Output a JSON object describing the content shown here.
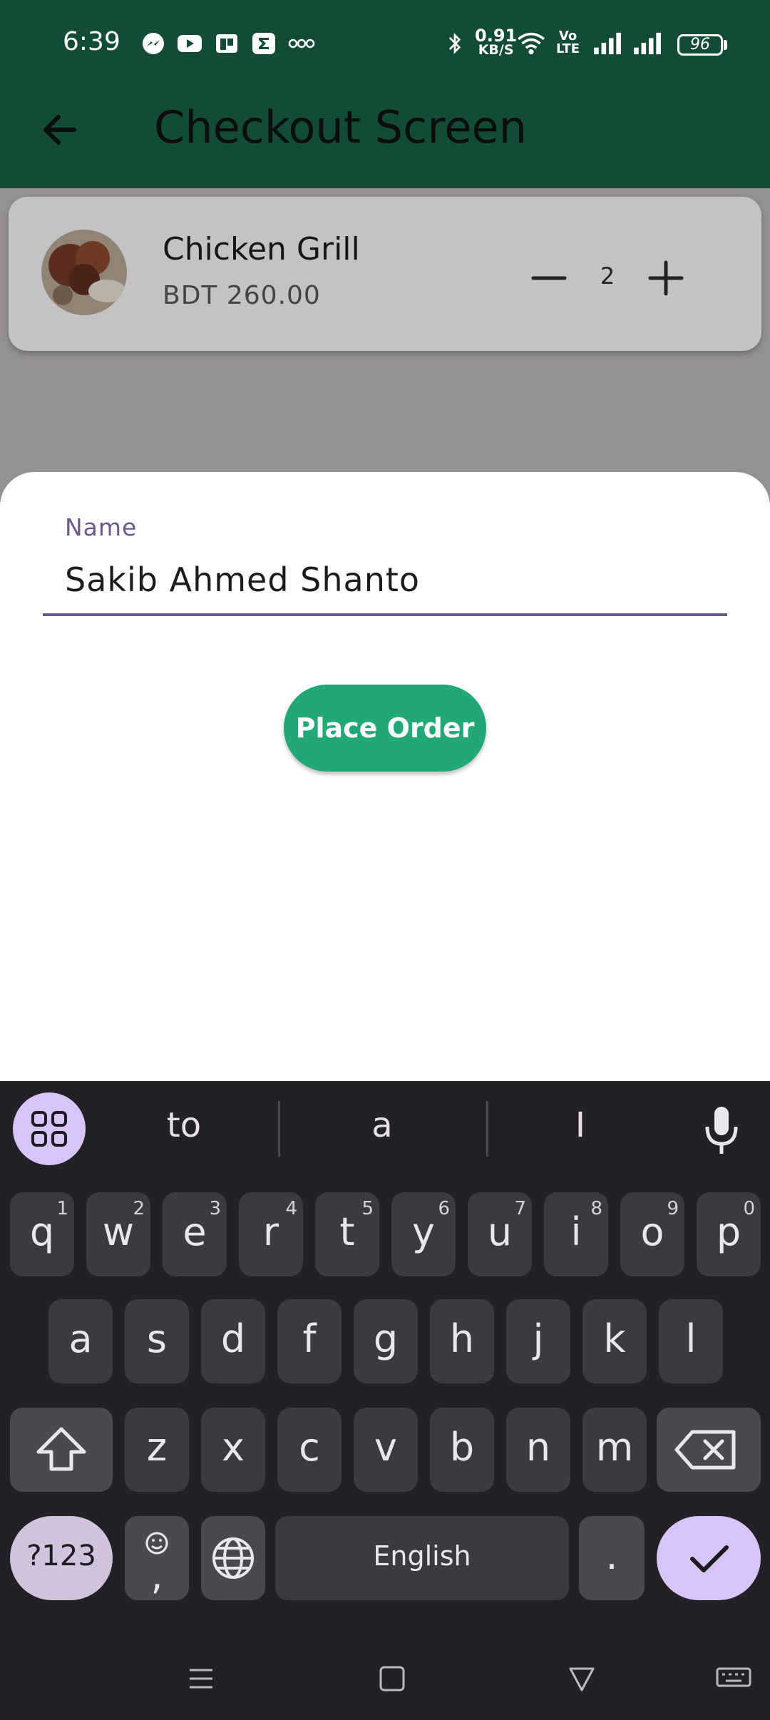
{
  "status_bar": {
    "time": "6:39",
    "net_speed_value": "0.91",
    "net_speed_unit": "KB/S",
    "volte_top": "Vo",
    "volte_bottom": "LTE",
    "battery": "96"
  },
  "app_bar": {
    "title": "Checkout Screen",
    "back_icon": "arrow-back-icon"
  },
  "cart_item": {
    "name": "Chicken Grill",
    "price": "BDT 260.00",
    "quantity": "2"
  },
  "sheet": {
    "name_label": "Name",
    "name_value": "Sakib Ahmed Shanto",
    "place_order_label": "Place Order"
  },
  "keyboard": {
    "suggestions": [
      "to",
      "a",
      "I"
    ],
    "row1": [
      {
        "key": "q",
        "sup": "1"
      },
      {
        "key": "w",
        "sup": "2"
      },
      {
        "key": "e",
        "sup": "3"
      },
      {
        "key": "r",
        "sup": "4"
      },
      {
        "key": "t",
        "sup": "5"
      },
      {
        "key": "y",
        "sup": "6"
      },
      {
        "key": "u",
        "sup": "7"
      },
      {
        "key": "i",
        "sup": "8"
      },
      {
        "key": "o",
        "sup": "9"
      },
      {
        "key": "p",
        "sup": "0"
      }
    ],
    "row2": [
      "a",
      "s",
      "d",
      "f",
      "g",
      "h",
      "j",
      "k",
      "l"
    ],
    "row3": [
      "z",
      "x",
      "c",
      "v",
      "b",
      "n",
      "m"
    ],
    "symbols_label": "?123",
    "comma_label": ",",
    "space_label": "English",
    "period_label": "."
  },
  "colors": {
    "app_bar": "#134c34",
    "place_order": "#22a875",
    "accent_purple": "#6b5a93",
    "keyboard_bg": "#222125",
    "keyboard_accent": "#d7c4f8"
  }
}
